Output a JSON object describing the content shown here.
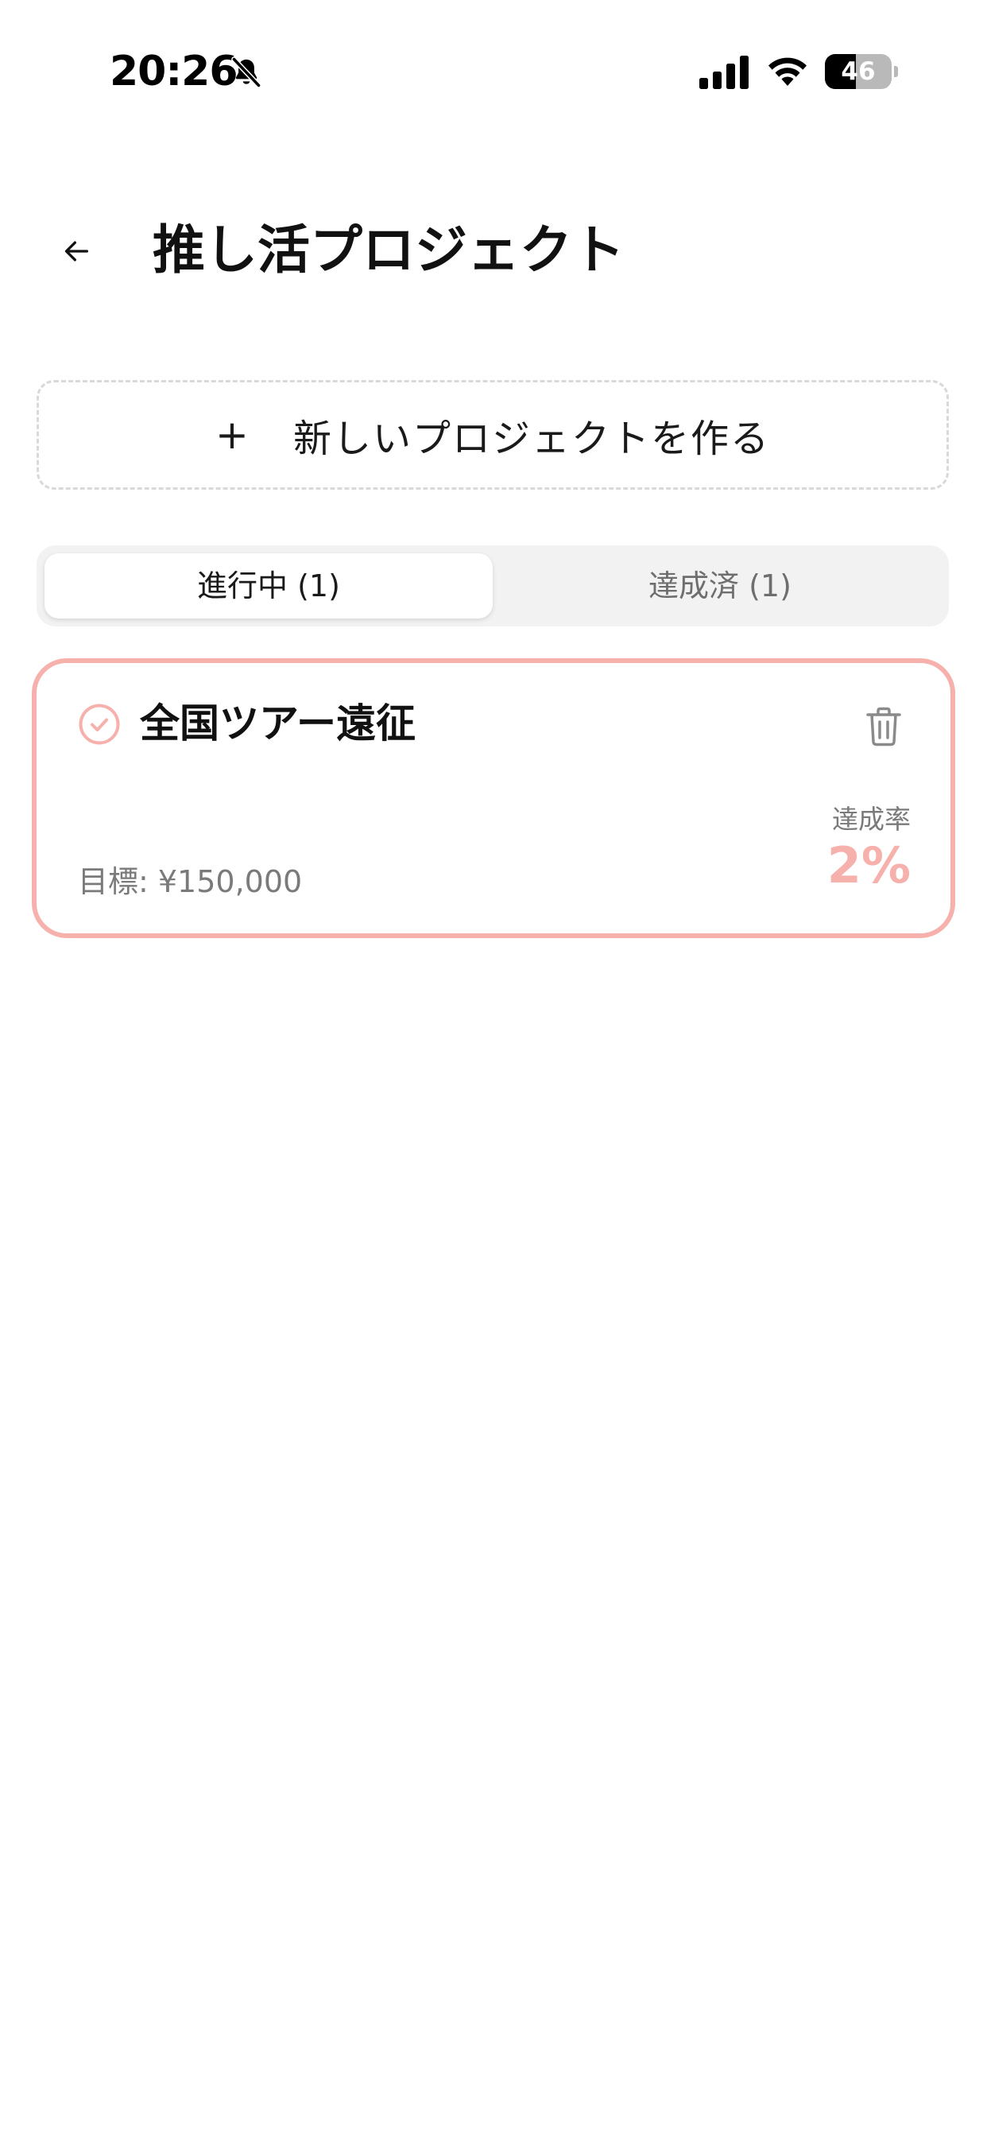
{
  "status_bar": {
    "time": "20:26",
    "battery_level": "46",
    "battery_fraction": 0.46,
    "icons": [
      "bell-slash-icon",
      "cellular-signal-icon",
      "wifi-icon",
      "battery-icon"
    ]
  },
  "header": {
    "back_icon": "arrow-left-icon",
    "title": "推し活プロジェクト"
  },
  "new_project": {
    "icon": "plus-icon",
    "plus_glyph": "+",
    "label": "新しいプロジェクトを作る"
  },
  "tabs": [
    {
      "label": "進行中 (1)",
      "active": true
    },
    {
      "label": "達成済 (1)",
      "active": false
    }
  ],
  "projects": [
    {
      "title": "全国ツアー遠征",
      "goal": "目標: ¥150,000",
      "rate_label": "達成率",
      "rate_value": "2%",
      "icons": [
        "check-circle-icon",
        "trash-icon"
      ]
    }
  ],
  "colors": {
    "accent": "#f7b1ac",
    "text_primary": "#111111",
    "text_secondary": "#7a7a7a",
    "tab_background": "#f2f2f2",
    "dashed_border": "#d9d9d9"
  }
}
